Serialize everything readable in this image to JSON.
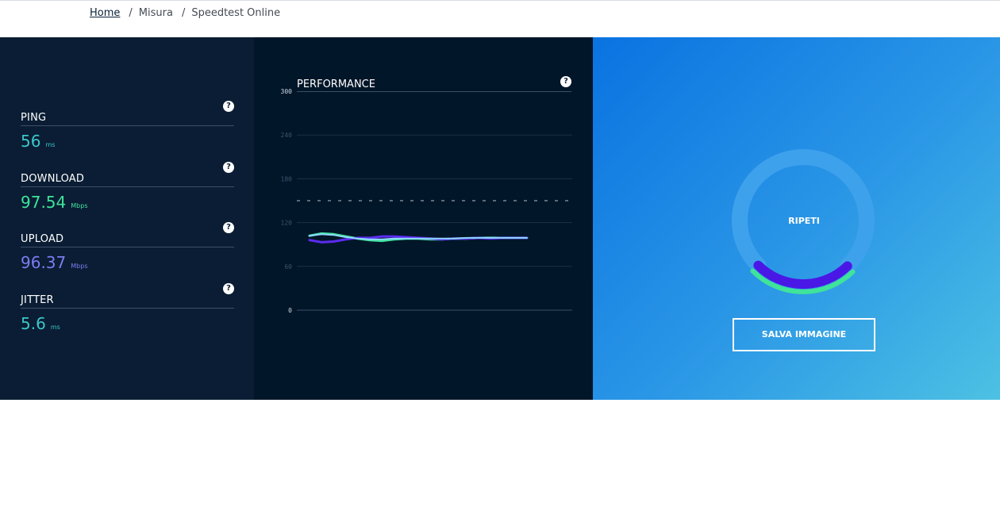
{
  "breadcrumb": {
    "home": "Home",
    "separator": "/",
    "misura": "Misura",
    "current": "Speedtest Online"
  },
  "metrics": [
    {
      "label": "PING",
      "value": "56",
      "unit": "ms",
      "color": "#3cc6c9"
    },
    {
      "label": "DOWNLOAD",
      "value": "97.54",
      "unit": "Mbps",
      "color": "#3fe39a"
    },
    {
      "label": "UPLOAD",
      "value": "96.37",
      "unit": "Mbps",
      "color": "#7d7bf2"
    },
    {
      "label": "JITTER",
      "value": "5.6",
      "unit": "ms",
      "color": "#3cc6c9"
    }
  ],
  "help_symbol": "?",
  "performance": {
    "title": "PERFORMANCE"
  },
  "chart_data": {
    "type": "line",
    "ylim": [
      0,
      300
    ],
    "yticks": [
      "0",
      "60",
      "120",
      "180",
      "240",
      "300"
    ],
    "reference_line": 150,
    "x": [
      0,
      1,
      2,
      3,
      4,
      5,
      6,
      7,
      8,
      9,
      10,
      11,
      12,
      13,
      14,
      15,
      16,
      17,
      18
    ],
    "series": [
      {
        "color": "#3fe39a",
        "values": [
          102,
          105,
          104,
          101,
          98,
          96,
          95,
          97,
          98,
          98,
          97,
          97,
          98,
          98,
          99,
          99,
          99,
          99,
          99
        ]
      },
      {
        "color": "#5b2cf0",
        "values": [
          96,
          93,
          94,
          97,
          99,
          99,
          101,
          101,
          100,
          99,
          98,
          97,
          98,
          98,
          99,
          98,
          99,
          99,
          99
        ]
      },
      {
        "color": "#8fd8ff",
        "values": [
          102,
          104,
          103,
          100,
          98,
          97,
          97,
          98,
          98,
          98,
          98,
          98,
          98,
          99,
          99,
          99,
          99,
          99,
          99
        ]
      }
    ]
  },
  "gauge": {
    "download_fraction": 0.33,
    "upload_fraction": 0.33,
    "track_color": "#3ea1ec",
    "download_color": "#3fe39a",
    "upload_color": "#4a18e6"
  },
  "buttons": {
    "repeat": "RIPETI",
    "save_image": "SALVA IMMAGINE"
  }
}
